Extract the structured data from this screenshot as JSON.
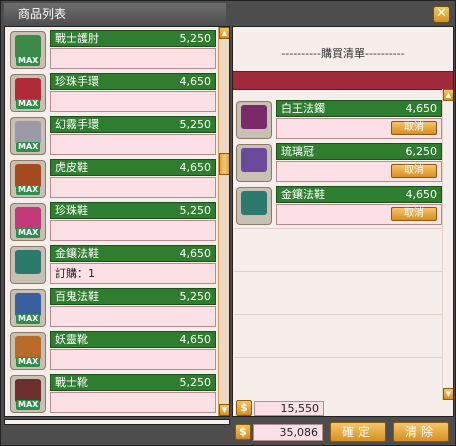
{
  "window": {
    "title": "商品列表",
    "close_glyph": "✕"
  },
  "products": [
    {
      "name": "戰士護肘",
      "price": "5,250",
      "max": "MAX",
      "note": "",
      "icon": "bracer-icon",
      "color": "#3c8a4a"
    },
    {
      "name": "珍珠手環",
      "price": "4,650",
      "max": "MAX",
      "note": "",
      "icon": "bracelet-icon",
      "color": "#b02a3a"
    },
    {
      "name": "幻霧手環",
      "price": "5,250",
      "max": "MAX",
      "note": "",
      "icon": "mist-bracelet-icon",
      "color": "#9a9aa8"
    },
    {
      "name": "虎皮鞋",
      "price": "4,650",
      "max": "MAX",
      "note": "",
      "icon": "boots-icon",
      "color": "#a24a1e"
    },
    {
      "name": "珍珠鞋",
      "price": "5,250",
      "max": "MAX",
      "note": "",
      "icon": "boots-icon",
      "color": "#c23a7a"
    },
    {
      "name": "金鑲法鞋",
      "price": "4,650",
      "max": "",
      "note": "訂購：1",
      "icon": "boots-icon",
      "color": "#2c7a6e"
    },
    {
      "name": "百鬼法鞋",
      "price": "5,250",
      "max": "MAX",
      "note": "",
      "icon": "boots-icon",
      "color": "#3a5fa0"
    },
    {
      "name": "妖靈靴",
      "price": "4,650",
      "max": "MAX",
      "note": "",
      "icon": "boots-icon",
      "color": "#b86a2a"
    },
    {
      "name": "戰士靴",
      "price": "5,250",
      "max": "MAX",
      "note": "",
      "icon": "boots-icon",
      "color": "#6b2f2f"
    }
  ],
  "cart": {
    "header": "----------購買清單----------",
    "cancel_label": "取消",
    "items": [
      {
        "name": "白王法鐲",
        "price": "4,650",
        "icon": "bracelet-icon",
        "color": "#7a2a6a"
      },
      {
        "name": "琉璃冠",
        "price": "6,250",
        "icon": "crown-icon",
        "color": "#6a4a9a"
      },
      {
        "name": "金鑲法鞋",
        "price": "4,650",
        "icon": "boots-icon",
        "color": "#2c7a6e"
      }
    ],
    "total": "15,550"
  },
  "footer": {
    "money_symbol": "$",
    "balance": "35,086",
    "confirm_label": "確定",
    "clear_label": "清除"
  },
  "colors": {
    "accent_green": "#2f7d2f",
    "accent_orange": "#e0a030",
    "panel_bg": "#f6eeea"
  }
}
